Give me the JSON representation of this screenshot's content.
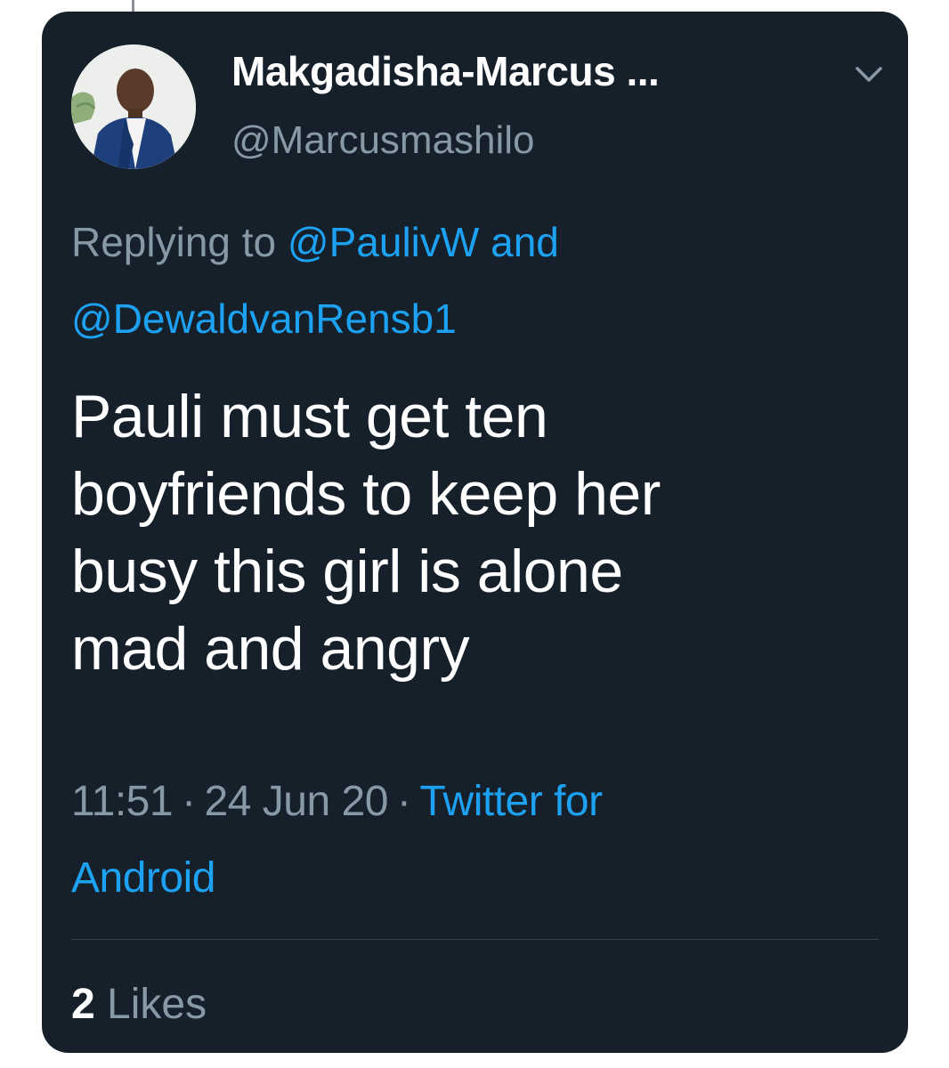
{
  "tweet": {
    "display_name": "Makgadisha-Marcus ...",
    "handle": "@Marcusmashilo",
    "replying_to_prefix": "Replying to",
    "reply_handle_1": "@PaulivW",
    "reply_and": "and",
    "reply_handle_2": "@DewaldvanRensb1",
    "text_lines": [
      "Pauli must get ten",
      "boyfriends to keep her",
      "busy this girl is alone",
      "mad and angry"
    ],
    "time": "11:51",
    "date": "24 Jun 20",
    "separator": "·",
    "source_line_1": "Twitter for",
    "source_line_2": "Android",
    "likes_count": "2",
    "likes_label": "Likes"
  },
  "icons": {
    "avatar": "profile-photo",
    "menu": "chevron-down-icon"
  },
  "colors": {
    "card_background": "#15202b",
    "link": "#1da1f2",
    "secondary_text": "#8899a6",
    "primary_text": "#ffffff"
  }
}
